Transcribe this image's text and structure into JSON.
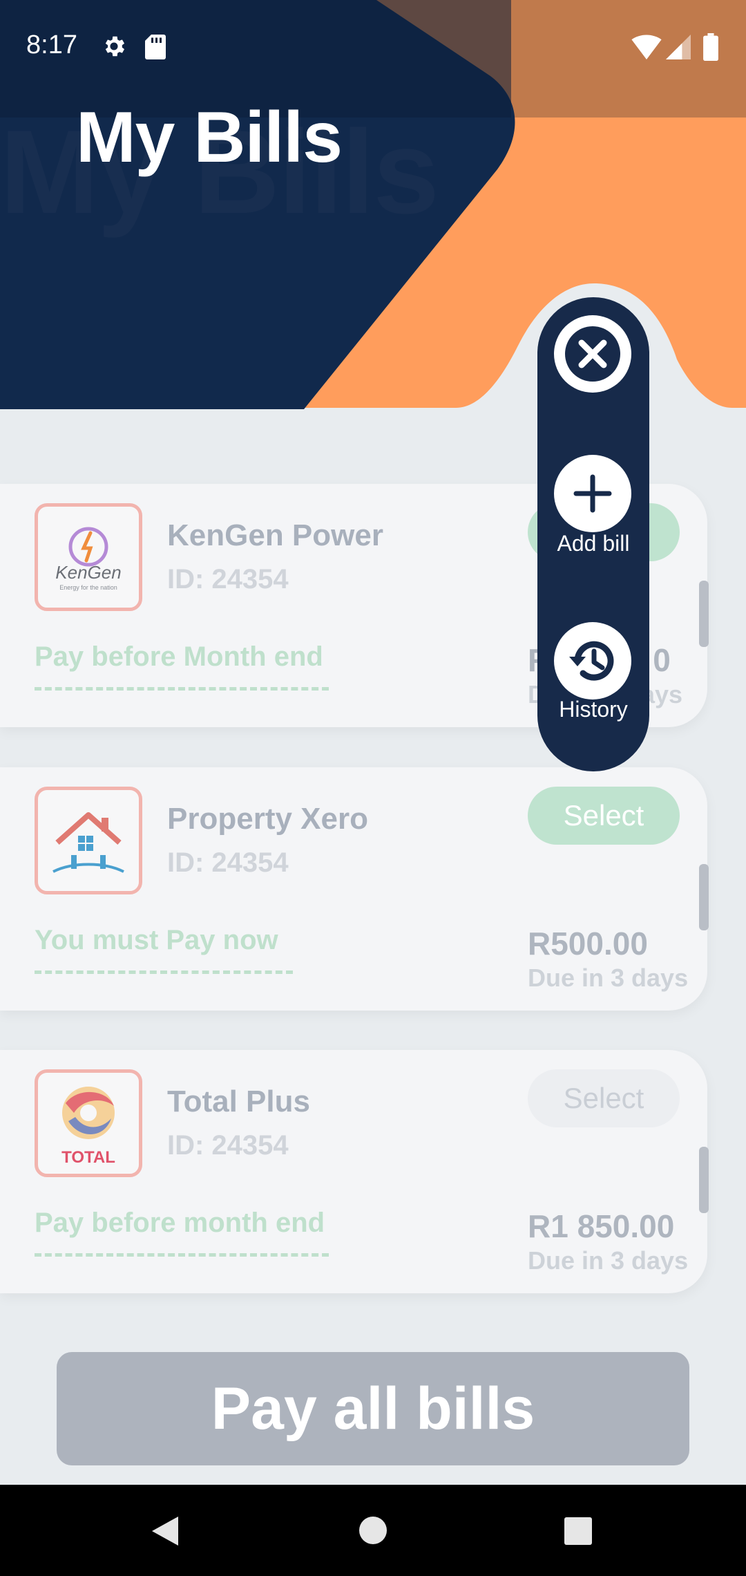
{
  "status_bar": {
    "time": "8:17",
    "icons": [
      "gear-icon",
      "sd-card-icon",
      "wifi-icon",
      "signal-icon",
      "battery-icon"
    ]
  },
  "header": {
    "title": "My Bills",
    "background_title": "My Bills"
  },
  "fab_menu": {
    "close_icon": "close-icon",
    "add_bill_label": "Add bill",
    "history_label": "History"
  },
  "bills": [
    {
      "logo": "kengen-logo",
      "logo_text": "KenGen",
      "logo_tagline": "Energy for the nation",
      "name": "KenGen Power",
      "id_text": "ID: 24354",
      "note": "Pay before Month end",
      "select_label": "",
      "amount": "R",
      "due": "D",
      "due_suffix": "ays",
      "amount_suffix": "0",
      "select_color": "#bfe3cf"
    },
    {
      "logo": "house-logo",
      "name": "Property Xero",
      "id_text": "ID: 24354",
      "note": "You must Pay now",
      "select_label": "Select",
      "amount": "R500.00",
      "due": "Due in 3 days",
      "select_color": "#bfe3cf"
    },
    {
      "logo": "total-logo",
      "logo_text": "TOTAL",
      "name": "Total Plus",
      "id_text": "ID: 24354",
      "note": "Pay before month end",
      "select_label": "Select",
      "amount": "R1 850.00",
      "due": "Due in 3 days",
      "select_color": "#eceef1"
    }
  ],
  "pay_all_label": "Pay all bills",
  "colors": {
    "navy": "#172a4a",
    "orange": "#ff9d5c",
    "accent_green": "#bfe0cc",
    "logo_border": "#f2b4ae"
  }
}
